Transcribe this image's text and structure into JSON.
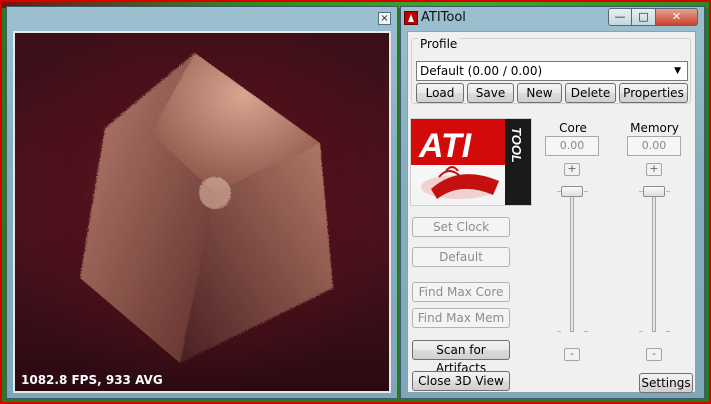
{
  "view3d": {
    "close_glyph": "×",
    "fps_text": "1082.8 FPS, 933 AVG"
  },
  "app": {
    "title": "ATITool",
    "minimize_glyph": "—",
    "maximize_glyph": "□",
    "close_glyph": "✕"
  },
  "profile": {
    "label": "Profile",
    "selected": "Default (0.00 / 0.00)",
    "buttons": {
      "load": "Load",
      "save": "Save",
      "new": "New",
      "delete": "Delete",
      "properties": "Properties"
    }
  },
  "logo": {
    "text_main": "ATI",
    "text_side": "TOOL"
  },
  "actions": {
    "set_clock": "Set Clock",
    "default": "Default",
    "find_max_core": "Find Max Core",
    "find_max_mem": "Find Max Mem",
    "scan_artifacts": "Scan for Artifacts",
    "close_3d": "Close 3D View",
    "settings": "Settings"
  },
  "core": {
    "label": "Core",
    "value": "0.00",
    "plus": "+",
    "minus": "-"
  },
  "memory": {
    "label": "Memory",
    "value": "0.00",
    "plus": "+",
    "minus": "-"
  },
  "colors": {
    "ati_red": "#d20a0a",
    "title_bg": "#8fb6c6"
  }
}
